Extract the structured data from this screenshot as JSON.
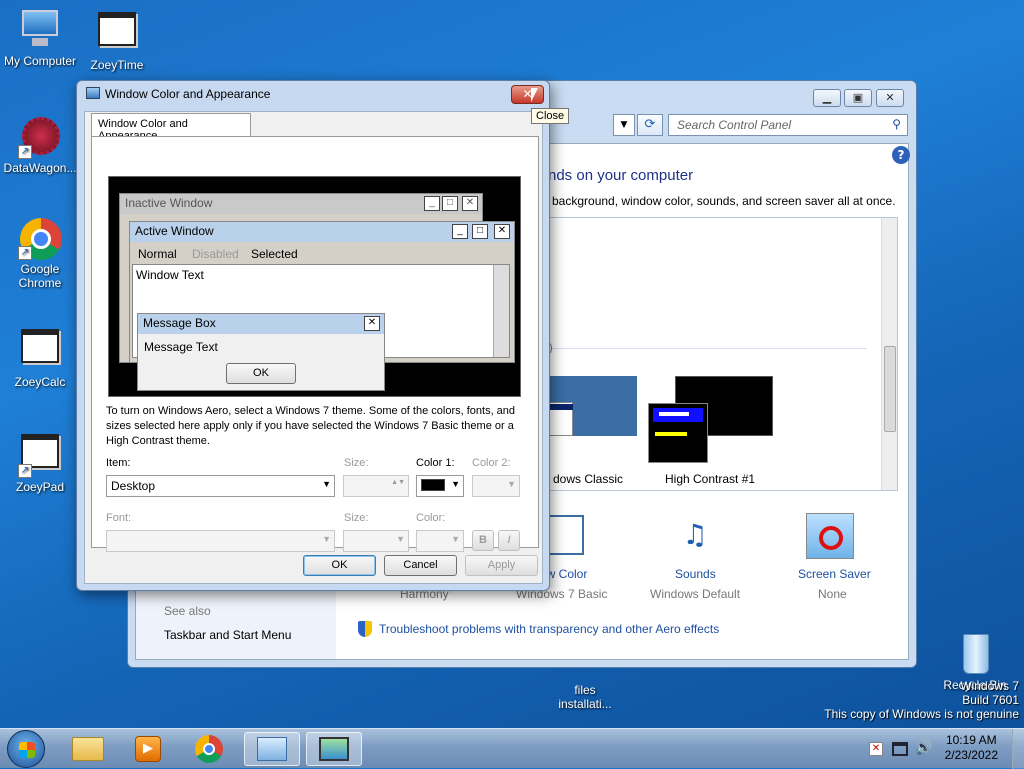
{
  "desktop": {
    "icons": [
      {
        "label": "My Computer"
      },
      {
        "label": "ZoeyTime"
      },
      {
        "label": "DataWagon..."
      },
      {
        "label": "Google Chrome"
      },
      {
        "label": "ZoeyCalc"
      },
      {
        "label": "ZoeyPad"
      },
      {
        "label": "files installati..."
      },
      {
        "label": "Recycle Bin"
      }
    ],
    "watermark": {
      "line1": "Windows 7",
      "line2": "Build 7601",
      "line3": "This copy of Windows is not genuine"
    }
  },
  "control_panel": {
    "search_placeholder": "Search Control Panel",
    "heading": "nds on your computer",
    "subheading": "background, window color, sounds, and screen saver all at once.",
    "theme_group_paren": ")",
    "themes": [
      {
        "label": "dows Classic"
      },
      {
        "label": "High Contrast #1"
      }
    ],
    "bottom_items": [
      {
        "title": "ow Color",
        "value": "Harmony"
      },
      {
        "title": "Sounds",
        "value": "Windows Default"
      },
      {
        "title": "Screen Saver",
        "value": "None"
      }
    ],
    "bottom_value_2": "Windows 7 Basic",
    "see_also": "See also",
    "taskbar_link": "Taskbar and Start Menu",
    "troubleshoot": "Troubleshoot problems with transparency and other Aero effects",
    "help_glyph": "?"
  },
  "dialog": {
    "title": "Window Color and Appearance",
    "close_tooltip": "Close",
    "tab_label": "Window Color and Appearance",
    "preview": {
      "inactive_title": "Inactive Window",
      "active_title": "Active Window",
      "menu_normal": "Normal",
      "menu_disabled": "Disabled",
      "menu_selected": "Selected",
      "window_text": "Window Text",
      "msgbox_title": "Message Box",
      "msgbox_text": "Message Text",
      "msgbox_ok": "OK"
    },
    "info": "To turn on Windows Aero, select a Windows 7 theme.  Some of the colors, fonts, and sizes selected here apply only if you have selected the Windows 7 Basic theme or a High Contrast theme.",
    "item_label": "Item:",
    "item_value": "Desktop",
    "size_label": "Size:",
    "color1_label": "Color 1:",
    "color2_label": "Color 2:",
    "font_label": "Font:",
    "font_size_label": "Size:",
    "font_color_label": "Color:",
    "bold_label": "B",
    "italic_label": "I",
    "ok": "OK",
    "cancel": "Cancel",
    "apply": "Apply"
  },
  "taskbar": {
    "time": "10:19 AM",
    "date": "2/23/2022"
  },
  "colors": {
    "accent": "#1e50a2",
    "titlebar": "#c6d9f1",
    "close_red": "#c4392b"
  }
}
